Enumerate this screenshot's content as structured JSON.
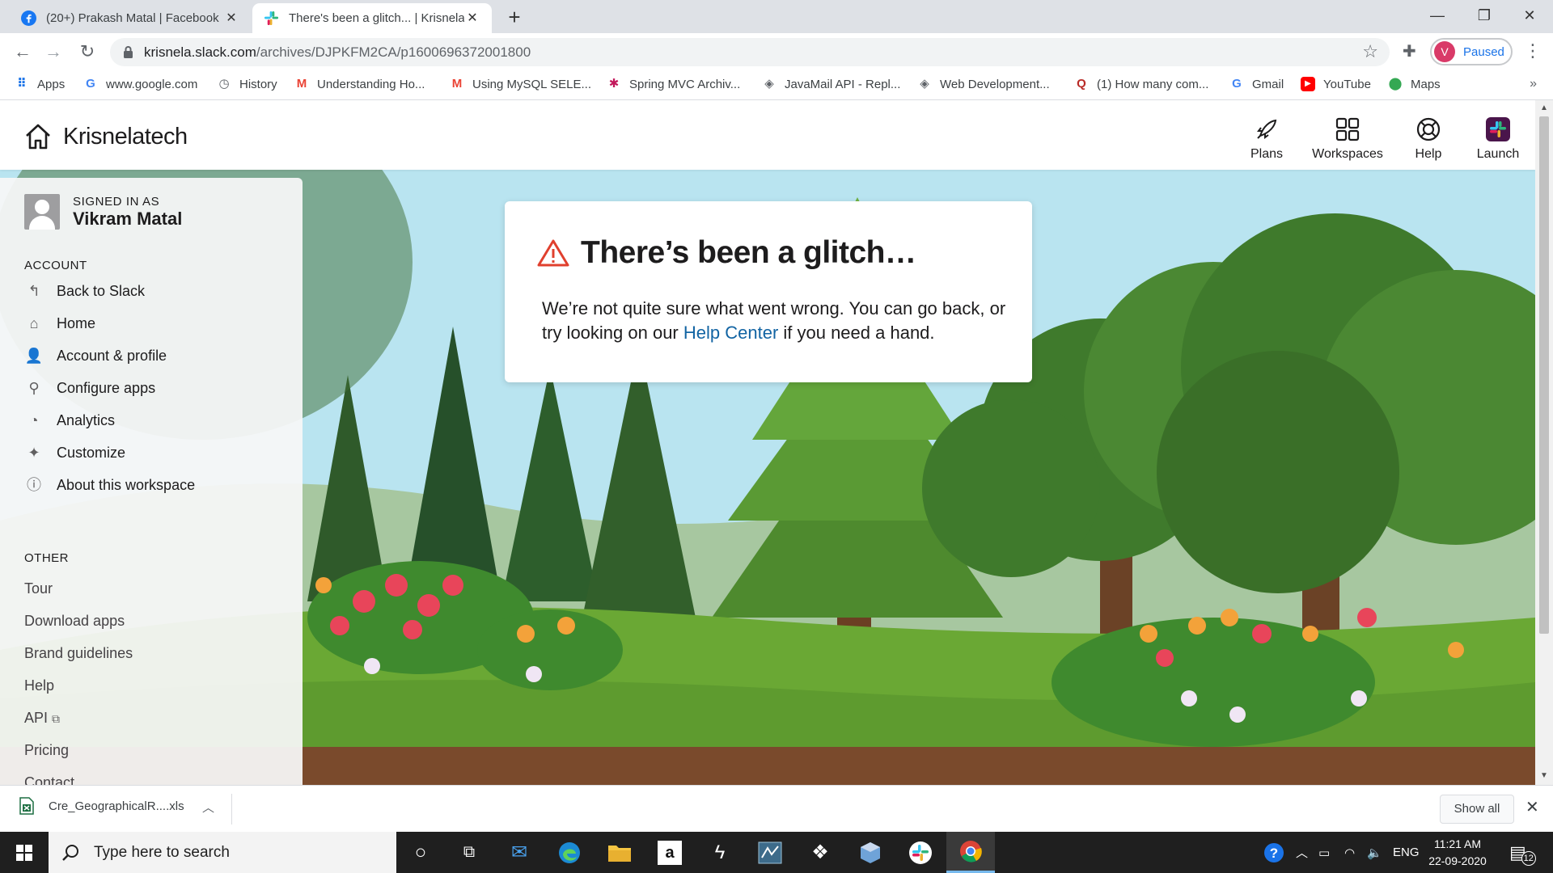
{
  "browser": {
    "tabs": [
      {
        "title": "(20+) Prakash Matal | Facebook",
        "active": false,
        "favicon": "facebook-icon"
      },
      {
        "title": "There's been a glitch... | Krisnelatech Slack",
        "active": true,
        "favicon": "slack-icon"
      }
    ],
    "window_controls": {
      "minimize": "—",
      "restore": "❐",
      "close": "✕"
    },
    "url_host": "krisnela.slack.com",
    "url_path": "/archives/DJPKFM2CA/p1600696372001800",
    "profile_initial": "V",
    "profile_status": "Paused",
    "bookmarks": [
      {
        "label": "Apps",
        "icon": "apps-grid-icon",
        "color": "#1a73e8"
      },
      {
        "label": "www.google.com",
        "icon": "google-icon",
        "color": "#4285f4"
      },
      {
        "label": "History",
        "icon": "history-icon",
        "color": "#5f6368"
      },
      {
        "label": "Understanding Ho...",
        "icon": "gmail-m-icon",
        "color": "#ea4335"
      },
      {
        "label": "Using MySQL SELE...",
        "icon": "gmail-m-icon",
        "color": "#ea4335"
      },
      {
        "label": "Spring MVC Archiv...",
        "icon": "bug-icon",
        "color": "#c2185b"
      },
      {
        "label": "JavaMail API - Repl...",
        "icon": "diamond-icon",
        "color": "#5f6368"
      },
      {
        "label": "Web Development...",
        "icon": "diamond-icon",
        "color": "#5f6368"
      },
      {
        "label": "(1) How many com...",
        "icon": "quora-icon",
        "color": "#b92b27"
      },
      {
        "label": "Gmail",
        "icon": "google-icon",
        "color": "#4285f4"
      },
      {
        "label": "YouTube",
        "icon": "youtube-icon",
        "color": "#ff0000"
      },
      {
        "label": "Maps",
        "icon": "maps-pin-icon",
        "color": "#34a853"
      }
    ],
    "bookmarks_more": "»"
  },
  "slack": {
    "workspace_name": "Krisnelatech",
    "top_nav": [
      {
        "label": "Plans",
        "icon": "rocket-icon"
      },
      {
        "label": "Workspaces",
        "icon": "grid-icon"
      },
      {
        "label": "Help",
        "icon": "lifebuoy-icon"
      },
      {
        "label": "Launch",
        "icon": "slack-logo-icon"
      }
    ],
    "sidebar": {
      "signed_in_label": "SIGNED IN AS",
      "user_name": "Vikram Matal",
      "account_heading": "ACCOUNT",
      "account_items": [
        {
          "label": "Back to Slack",
          "icon": "back-arrow-icon",
          "glyph": "↰"
        },
        {
          "label": "Home",
          "icon": "home-icon",
          "glyph": "⌂"
        },
        {
          "label": "Account & profile",
          "icon": "person-icon",
          "glyph": "👤"
        },
        {
          "label": "Configure apps",
          "icon": "plug-icon",
          "glyph": "⚲"
        },
        {
          "label": "Analytics",
          "icon": "gauge-icon",
          "glyph": "◔"
        },
        {
          "label": "Customize",
          "icon": "magic-wand-icon",
          "glyph": "✦"
        },
        {
          "label": "About this workspace",
          "icon": "info-icon",
          "glyph": "ⓘ"
        }
      ],
      "other_heading": "OTHER",
      "other_items": [
        "Tour",
        "Download apps",
        "Brand guidelines",
        "Help",
        "API",
        "Pricing",
        "Contact"
      ]
    },
    "error": {
      "title": "There’s been a glitch…",
      "message_before_link": "We’re not quite sure what went wrong. You can go back, or try looking on our ",
      "link_text": "Help Center",
      "message_after_link": " if you need a hand."
    }
  },
  "downloads": {
    "file_name": "Cre_GeographicalR....xls",
    "show_all": "Show all",
    "close": "✕"
  },
  "taskbar": {
    "search_placeholder": "Type here to search",
    "apps": [
      "cortana-icon",
      "task-view-icon",
      "mail-icon",
      "edge-icon",
      "file-explorer-icon",
      "amazon-icon",
      "winamp-icon",
      "mysql-workbench-icon",
      "dropbox-icon",
      "virtualbox-icon",
      "slack-icon",
      "chrome-icon"
    ],
    "language": "ENG",
    "time": "11:21 AM",
    "date": "22-09-2020",
    "notifications_count": "12"
  },
  "colors": {
    "link": "#1264a3",
    "warning": "#e01e5a",
    "sky": "#b9e4f0",
    "grass": "#6aa834",
    "taskbar": "#1f1f1f"
  }
}
